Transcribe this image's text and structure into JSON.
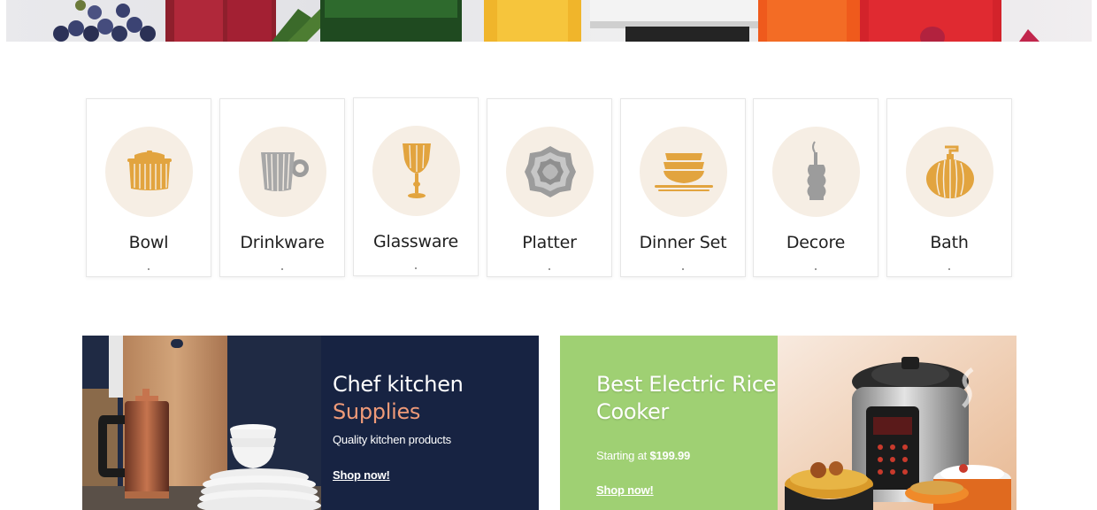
{
  "categories": [
    {
      "label": "Bowl",
      "icon": "bowl-icon"
    },
    {
      "label": "Drinkware",
      "icon": "drinkware-icon"
    },
    {
      "label": "Glassware",
      "icon": "glassware-icon"
    },
    {
      "label": "Platter",
      "icon": "platter-icon"
    },
    {
      "label": "Dinner Set",
      "icon": "dinner-set-icon"
    },
    {
      "label": "Decore",
      "icon": "decore-icon"
    },
    {
      "label": "Bath",
      "icon": "bath-icon"
    }
  ],
  "banner_left": {
    "title": "Chef kitchen",
    "subtitle": "Supplies",
    "description": "Quality kitchen products",
    "link": "Shop now!",
    "bg_color": "#172342",
    "accent_color": "#ef9a78"
  },
  "banner_right": {
    "title": "Best Electric Rice Cooker",
    "price_prefix": "Starting at",
    "price": "$199.99",
    "link": "Shop now!",
    "bg_color": "#9fd073"
  },
  "colors": {
    "icon_gold": "#e2a43f",
    "icon_gray": "#9c9c9c",
    "circle_bg": "#f6eee4"
  }
}
